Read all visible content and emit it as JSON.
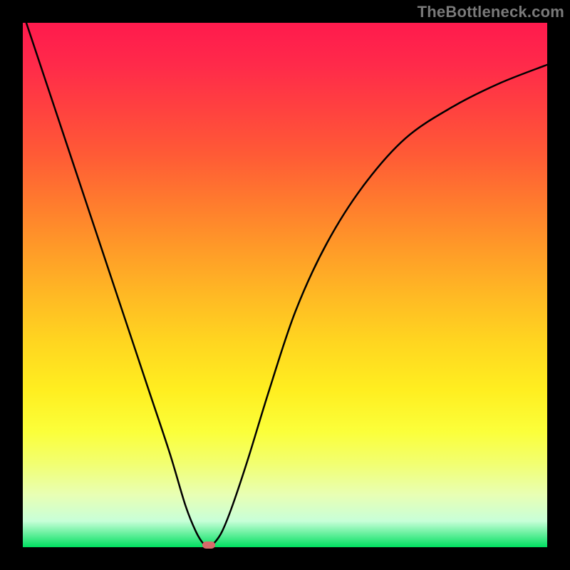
{
  "watermark": "TheBottleneck.com",
  "chart_data": {
    "type": "line",
    "title": "",
    "xlabel": "",
    "ylabel": "",
    "xlim": [
      0,
      100
    ],
    "ylim": [
      0,
      100
    ],
    "series": [
      {
        "name": "curve",
        "x": [
          0,
          4,
          8,
          12,
          16,
          20,
          24,
          28,
          31,
          33,
          34.5,
          35.5,
          36.5,
          38,
          40,
          43,
          47,
          52,
          58,
          65,
          73,
          82,
          91,
          100
        ],
        "y": [
          102,
          90,
          78,
          66,
          54,
          42,
          30,
          18,
          8,
          3,
          0.6,
          0.2,
          0.8,
          3,
          8,
          17,
          30,
          45,
          58,
          69,
          78,
          84,
          88.5,
          92
        ]
      }
    ],
    "marker": {
      "x": 35.5,
      "y": 0.4
    },
    "colors": {
      "curve": "#000000",
      "marker": "#d86a6a",
      "gradient_top": "#ff1a4d",
      "gradient_bottom": "#00e060"
    }
  }
}
